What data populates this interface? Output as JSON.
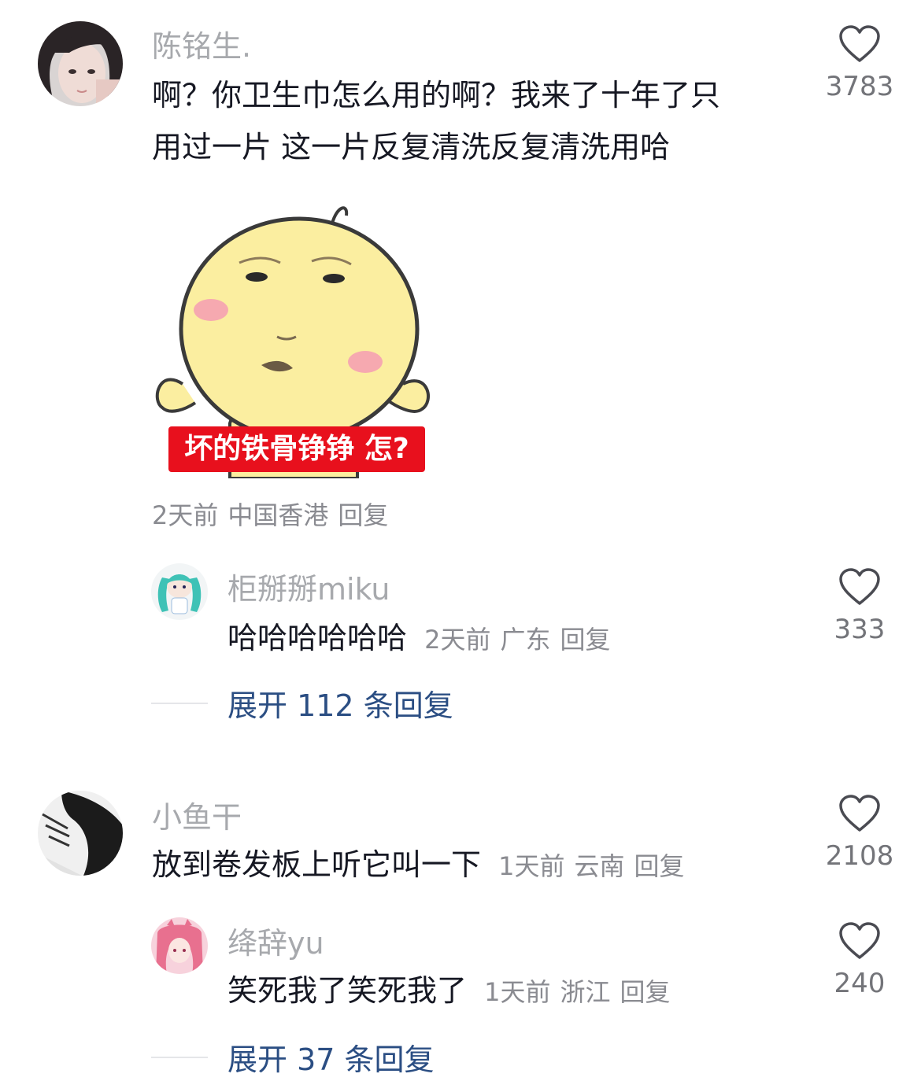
{
  "comments": [
    {
      "username": "陈铭生.",
      "text_line1": "啊？你卫生巾怎么用的啊？我来了十年了只",
      "text_line2": "用过一片 这一片反复清洗反复清洗用哈",
      "sticker_caption": "坏的铁骨铮铮 怎?",
      "time": "2天前",
      "location": "中国香港",
      "reply_label": "回复",
      "likes": "3783",
      "replies": [
        {
          "username": "柜掰掰miku",
          "text": "哈哈哈哈哈哈",
          "time": "2天前",
          "location": "广东",
          "reply_label": "回复",
          "likes": "333"
        }
      ],
      "expand_label": "展开 112 条回复"
    },
    {
      "username": "小鱼干",
      "text": "放到卷发板上听它叫一下",
      "time": "1天前",
      "location": "云南",
      "reply_label": "回复",
      "likes": "2108",
      "replies": [
        {
          "username": "绛辞yu",
          "text": "笑死我了笑死我了",
          "time": "1天前",
          "location": "浙江",
          "reply_label": "回复",
          "likes": "240"
        }
      ],
      "expand_label": "展开 37 条回复"
    }
  ],
  "icons": {
    "like": "heart-outline-icon"
  },
  "colors": {
    "username": "#a7a9ad",
    "text": "#161823",
    "meta": "#8a8b91",
    "expand": "#2b4e83",
    "caption_bg": "#e8101d"
  }
}
